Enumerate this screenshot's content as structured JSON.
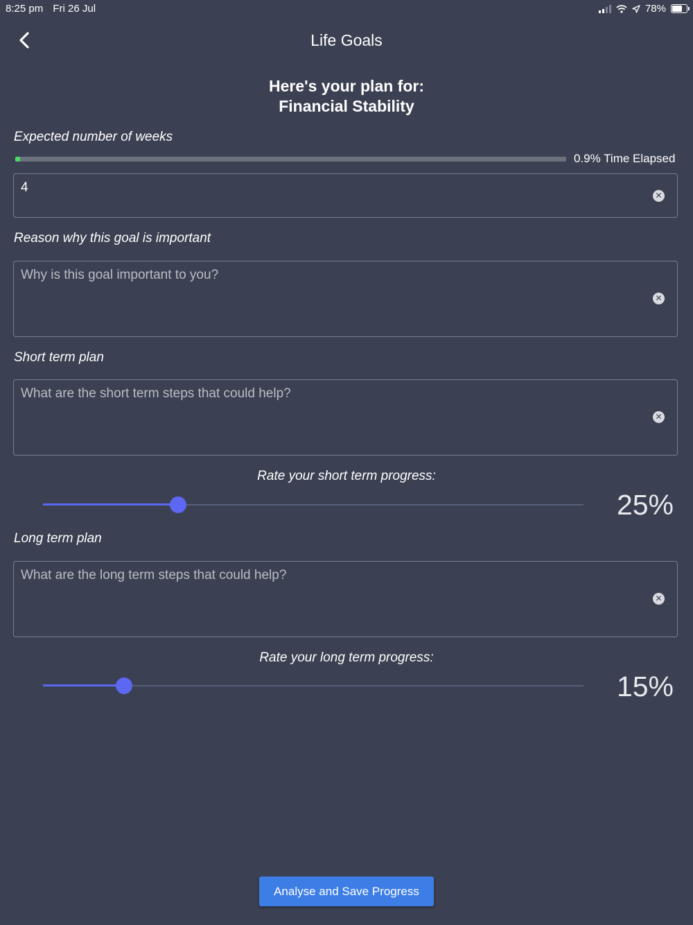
{
  "status_bar": {
    "time": "8:25 pm",
    "date": "Fri 26 Jul",
    "battery_text": "78%",
    "battery_level": 0.78
  },
  "nav": {
    "title": "Life Goals",
    "back_icon": "chevron-left-icon"
  },
  "plan": {
    "line1": "Here's your plan for:",
    "line2": "Financial Stability"
  },
  "weeks": {
    "label": "Expected number of weeks",
    "elapsed_text": "0.9% Time Elapsed",
    "elapsed_fraction": 0.009,
    "value": "4"
  },
  "reason": {
    "label": "Reason why this goal is important",
    "placeholder": "Why is this goal important to you?"
  },
  "short_term": {
    "label": "Short term plan",
    "placeholder": "What are the short term steps that could help?",
    "rate_label": "Rate your short term progress:",
    "percent_text": "25%",
    "value": 0.25
  },
  "long_term": {
    "label": "Long term plan",
    "placeholder": "What are the long term steps that could help?",
    "rate_label": "Rate your long term progress:",
    "percent_text": "15%",
    "value": 0.15
  },
  "save_button": {
    "label": "Analyse and Save Progress"
  },
  "colors": {
    "background": "#3b4152",
    "accent": "#5c67f2",
    "button": "#3d7ee6",
    "elapsed": "#4cd964"
  }
}
